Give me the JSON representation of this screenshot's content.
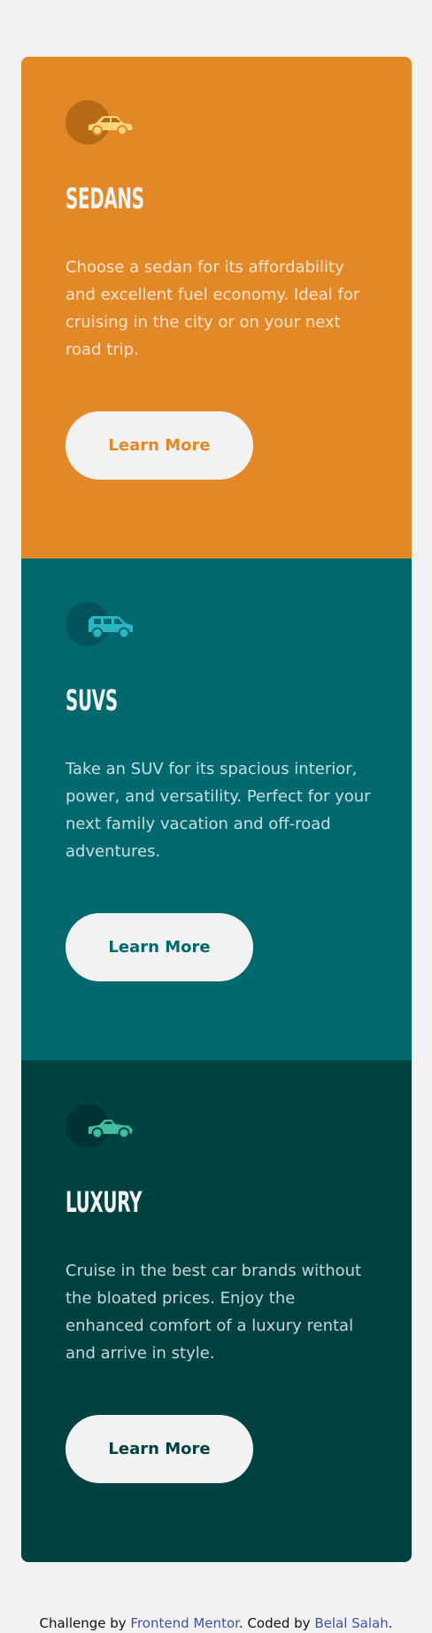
{
  "cards": [
    {
      "title": "Sedans",
      "description": "Choose a sedan for its affordability and excellent fuel economy. Ideal for cruising in the city or on your next road trip.",
      "button_label": "Learn More",
      "icon": "sedan-car-icon",
      "background": "#e38826"
    },
    {
      "title": "SUVs",
      "description": "Take an SUV for its spacious interior, power, and versatility. Perfect for your next family vacation and off-road adventures.",
      "button_label": "Learn More",
      "icon": "suv-car-icon",
      "background": "#006970"
    },
    {
      "title": "Luxury",
      "description": "Cruise in the best car brands without the bloated prices. Enjoy the enhanced comfort of a luxury rental and arrive in style.",
      "button_label": "Learn More",
      "icon": "luxury-car-icon",
      "background": "#004141"
    }
  ],
  "footer": {
    "prefix": "Challenge by ",
    "challenge_link": "Frontend Mentor",
    "middle": ". Coded by ",
    "author_link": "Belal Salah",
    "suffix": "."
  }
}
